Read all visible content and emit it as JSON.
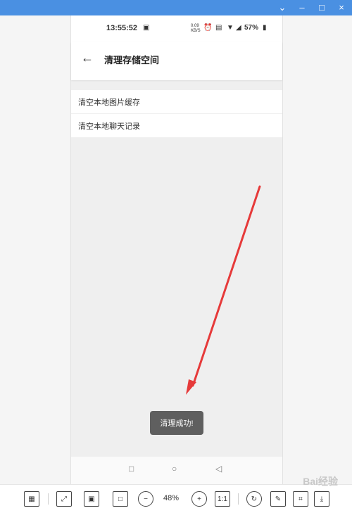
{
  "window": {
    "controls": [
      "⌄",
      "–",
      "□",
      "×"
    ]
  },
  "phone": {
    "time": "13:55:52",
    "network_speed": "0.09",
    "network_unit": "KB/S",
    "battery": "57%",
    "appbar": {
      "title": "清理存储空间"
    },
    "list": [
      {
        "label": "清空本地图片缓存"
      },
      {
        "label": "清空本地聊天记录"
      }
    ],
    "toast": "清理成功!"
  },
  "toolbar": {
    "zoom": "48%"
  },
  "watermark": "Bai经验"
}
